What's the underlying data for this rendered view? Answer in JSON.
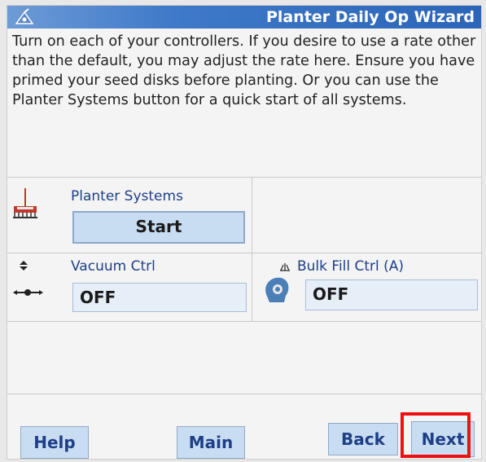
{
  "window": {
    "title": "Planter Daily Op Wizard",
    "app_icon": "planter-app-icon"
  },
  "instructions": "Turn on each of your controllers. If you desire to use a rate other than the default, you may adjust the rate here. Ensure you have primed your seed disks before planting. Or you can use the Planter Systems button for a quick start of all systems.",
  "controllers": {
    "planter_systems": {
      "label": "Planter Systems",
      "button_label": "Start",
      "icon": "planter-icon"
    },
    "vacuum": {
      "label": "Vacuum Ctrl",
      "value": "OFF",
      "icon": "vacuum-icon"
    },
    "bulk_fill": {
      "label": "Bulk Fill Ctrl (A)",
      "value": "OFF",
      "icon": "bulk-fill-icon"
    }
  },
  "buttons": {
    "help": "Help",
    "main": "Main",
    "back": "Back",
    "next": "Next"
  },
  "colors": {
    "title_bar": "#2c65b8",
    "label_text": "#1e3f86",
    "button_fill": "#c8dcf2",
    "highlight": "#ee1111"
  }
}
